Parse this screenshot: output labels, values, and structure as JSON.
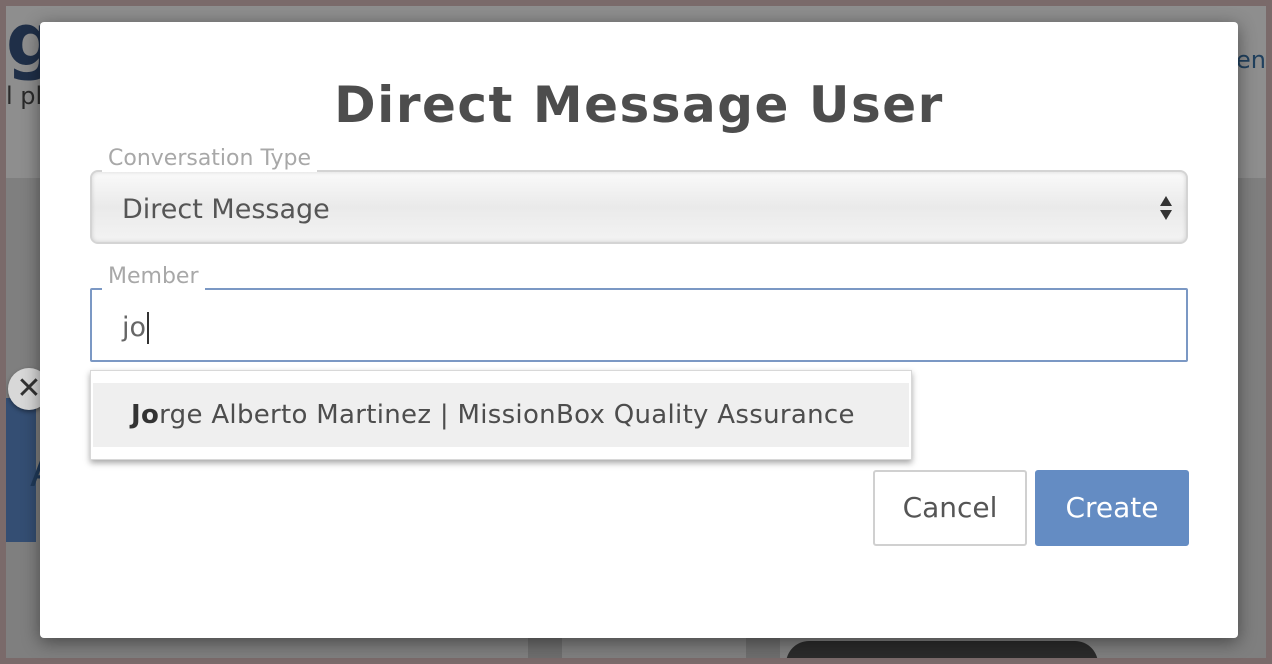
{
  "background": {
    "brand_text": "g",
    "sub_text": "l pl",
    "link_text": "en",
    "blue_letter": "A",
    "close_glyph": "✕"
  },
  "dialog": {
    "title": "Direct Message User",
    "conversation_type": {
      "label": "Conversation Type",
      "value": "Direct Message"
    },
    "member": {
      "label": "Member",
      "value": "jo"
    },
    "suggestions": [
      {
        "match": "Jo",
        "rest": "rge Alberto Martinez | MissionBox Quality Assurance"
      }
    ],
    "buttons": {
      "cancel": "Cancel",
      "create": "Create"
    }
  },
  "colors": {
    "primary": "#648cc3",
    "input_focus_border": "#7b98c4",
    "overlay": "#7f7f7f"
  },
  "icons": {
    "select_arrows": "chevron-up-down-icon",
    "background_close": "close-icon"
  }
}
